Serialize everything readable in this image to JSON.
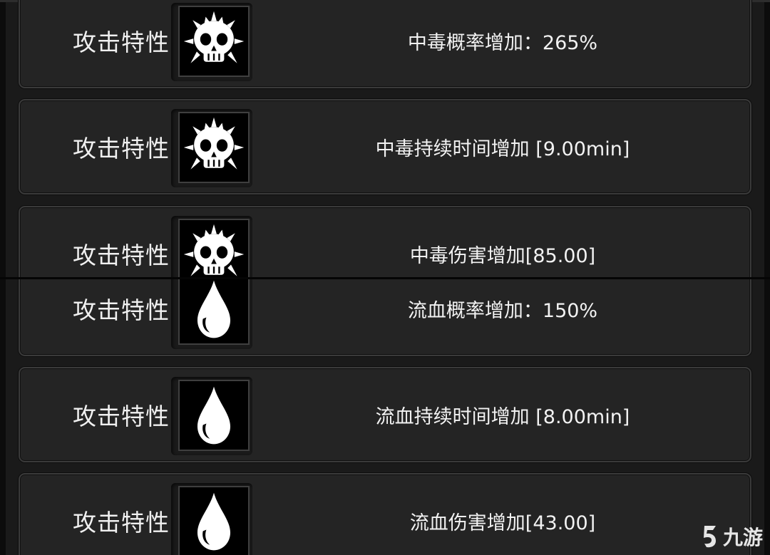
{
  "rows": [
    {
      "label": "攻击特性",
      "icon": "poison-skull-icon",
      "value": "中毒概率增加：265%"
    },
    {
      "label": "攻击特性",
      "icon": "poison-skull-icon",
      "value": "中毒持续时间增加 [9.00min]"
    },
    {
      "label": "攻击特性",
      "icon": "poison-skull-icon",
      "value": "中毒伤害增加[85.00]"
    },
    {
      "label": "攻击特性",
      "icon": "blood-drop-icon",
      "value": "流血概率增加：150%"
    },
    {
      "label": "攻击特性",
      "icon": "blood-drop-icon",
      "value": "流血持续时间增加 [8.00min]"
    },
    {
      "label": "攻击特性",
      "icon": "blood-drop-icon",
      "value": "流血伤害增加[43.00]"
    }
  ],
  "watermark": {
    "text": "九游",
    "icon": "jiuyou-logo-icon"
  },
  "colors": {
    "background": "#151515",
    "row_fill": "#242424",
    "row_border": "#3a3a3a",
    "icon_bg": "#000000",
    "text": "#f0f0f0"
  }
}
